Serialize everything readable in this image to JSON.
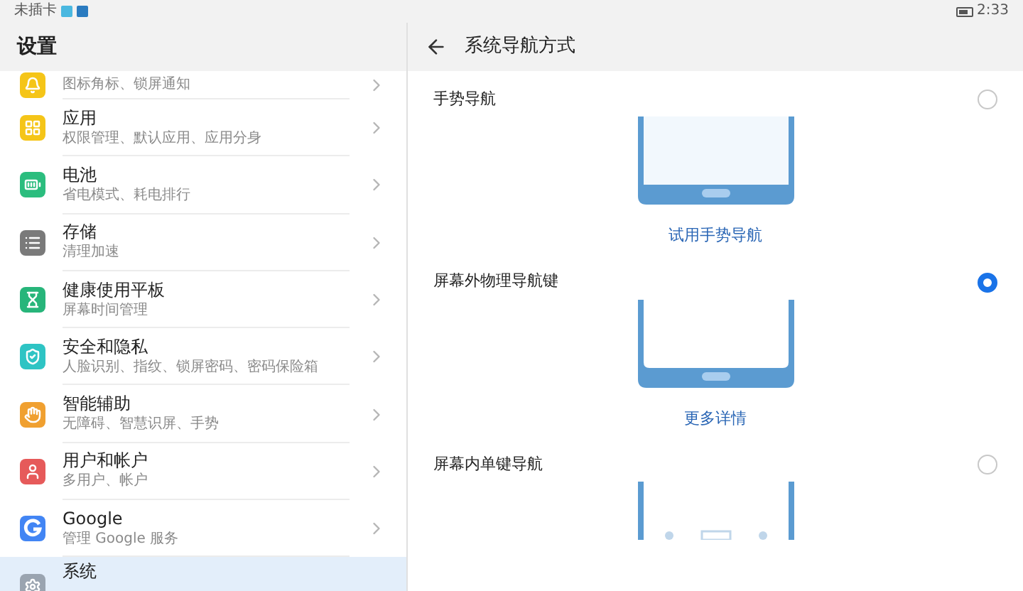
{
  "status_bar": {
    "left": "未插卡",
    "time": "2:33"
  },
  "settings": {
    "title": "设置",
    "items": [
      {
        "subtitle": "图标角标、锁屏通知",
        "kind": "bell",
        "color": "#f5c518",
        "selected": false
      },
      {
        "title": "应用",
        "subtitle": "权限管理、默认应用、应用分身",
        "kind": "apps",
        "color": "#f5c518",
        "selected": false
      },
      {
        "title": "电池",
        "subtitle": "省电模式、耗电排行",
        "kind": "battery",
        "color": "#2bbd7e",
        "selected": false
      },
      {
        "title": "存储",
        "subtitle": "清理加速",
        "kind": "storage",
        "color": "#7a7a7a",
        "selected": false
      },
      {
        "title": "健康使用平板",
        "subtitle": "屏幕时间管理",
        "kind": "hourglass",
        "color": "#27b57a",
        "selected": false
      },
      {
        "title": "安全和隐私",
        "subtitle": "人脸识别、指纹、锁屏密码、密码保险箱",
        "kind": "shield",
        "color": "#2ec4c4",
        "selected": false
      },
      {
        "title": "智能辅助",
        "subtitle": "无障碍、智慧识屏、手势",
        "kind": "hand",
        "color": "#f0a030",
        "selected": false
      },
      {
        "title": "用户和帐户",
        "subtitle": "多用户、帐户",
        "kind": "user",
        "color": "#e65a5a",
        "selected": false
      },
      {
        "title": "Google",
        "subtitle": "管理 Google 服务",
        "kind": "google",
        "color": "#4285f4",
        "selected": false
      },
      {
        "title": "系统",
        "kind": "system",
        "color": "#9aa4b0",
        "selected": true
      }
    ]
  },
  "detail": {
    "title": "系统导航方式",
    "options": [
      {
        "label": "手势导航",
        "selected": false,
        "kind": "gesture",
        "link": "试用手势导航"
      },
      {
        "label": "屏幕外物理导航键",
        "selected": true,
        "kind": "physical",
        "link": "更多详情"
      },
      {
        "label": "屏幕内单键导航",
        "selected": false,
        "kind": "single"
      }
    ]
  }
}
